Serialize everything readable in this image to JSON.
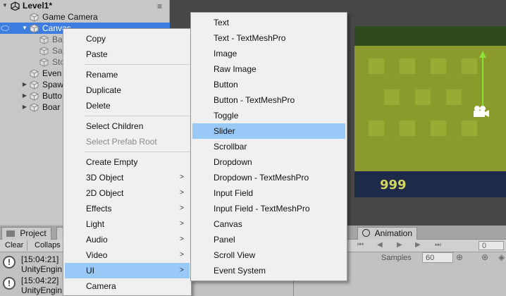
{
  "hierarchy": {
    "scene_title": "Level1*",
    "items": [
      {
        "label": "Game Camera"
      },
      {
        "label": "Canvas"
      },
      {
        "label": "Ba"
      },
      {
        "label": "Sa"
      },
      {
        "label": "Sto"
      },
      {
        "label": "Even"
      },
      {
        "label": "Spaw"
      },
      {
        "label": "Butto"
      },
      {
        "label": "Boar"
      }
    ]
  },
  "lower": {
    "project_tab": "Project",
    "clear_label": "Clear",
    "collapse_label": "Collaps",
    "logs": [
      {
        "time": "[15:04:21]",
        "source": "UnityEngin"
      },
      {
        "time": "[15:04:22]",
        "source": "UnityEngin"
      }
    ]
  },
  "animation": {
    "tab_label": "Animation",
    "frame_value": "0",
    "samples_label": "Samples",
    "samples_value": "60"
  },
  "scene": {
    "score": "999"
  },
  "context_menu": {
    "items": [
      {
        "label": "Copy"
      },
      {
        "label": "Paste"
      },
      {
        "label": "Rename"
      },
      {
        "label": "Duplicate"
      },
      {
        "label": "Delete"
      },
      {
        "label": "Select Children"
      },
      {
        "label": "Select Prefab Root"
      },
      {
        "label": "Create Empty"
      },
      {
        "label": "3D Object"
      },
      {
        "label": "2D Object"
      },
      {
        "label": "Effects"
      },
      {
        "label": "Light"
      },
      {
        "label": "Audio"
      },
      {
        "label": "Video"
      },
      {
        "label": "UI"
      },
      {
        "label": "Camera"
      }
    ]
  },
  "ui_submenu": {
    "items": [
      {
        "label": "Text"
      },
      {
        "label": "Text - TextMeshPro"
      },
      {
        "label": "Image"
      },
      {
        "label": "Raw Image"
      },
      {
        "label": "Button"
      },
      {
        "label": "Button - TextMeshPro"
      },
      {
        "label": "Toggle"
      },
      {
        "label": "Slider"
      },
      {
        "label": "Scrollbar"
      },
      {
        "label": "Dropdown"
      },
      {
        "label": "Dropdown - TextMeshPro"
      },
      {
        "label": "Input Field"
      },
      {
        "label": "Input Field - TextMeshPro"
      },
      {
        "label": "Canvas"
      },
      {
        "label": "Panel"
      },
      {
        "label": "Scroll View"
      },
      {
        "label": "Event System"
      }
    ]
  },
  "colors": {
    "selection": "#3e7de0",
    "menu_highlight": "#99c9f6",
    "menu_bg": "#f0f0f0"
  }
}
